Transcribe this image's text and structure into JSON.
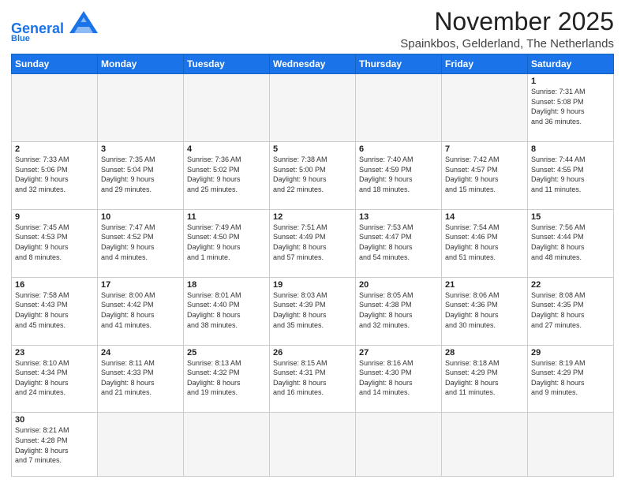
{
  "header": {
    "logo_general": "General",
    "logo_blue": "Blue",
    "month": "November 2025",
    "location": "Spainkbos, Gelderland, The Netherlands"
  },
  "days_of_week": [
    "Sunday",
    "Monday",
    "Tuesday",
    "Wednesday",
    "Thursday",
    "Friday",
    "Saturday"
  ],
  "weeks": [
    [
      {
        "day": "",
        "info": ""
      },
      {
        "day": "",
        "info": ""
      },
      {
        "day": "",
        "info": ""
      },
      {
        "day": "",
        "info": ""
      },
      {
        "day": "",
        "info": ""
      },
      {
        "day": "",
        "info": ""
      },
      {
        "day": "1",
        "info": "Sunrise: 7:31 AM\nSunset: 5:08 PM\nDaylight: 9 hours\nand 36 minutes."
      }
    ],
    [
      {
        "day": "2",
        "info": "Sunrise: 7:33 AM\nSunset: 5:06 PM\nDaylight: 9 hours\nand 32 minutes."
      },
      {
        "day": "3",
        "info": "Sunrise: 7:35 AM\nSunset: 5:04 PM\nDaylight: 9 hours\nand 29 minutes."
      },
      {
        "day": "4",
        "info": "Sunrise: 7:36 AM\nSunset: 5:02 PM\nDaylight: 9 hours\nand 25 minutes."
      },
      {
        "day": "5",
        "info": "Sunrise: 7:38 AM\nSunset: 5:00 PM\nDaylight: 9 hours\nand 22 minutes."
      },
      {
        "day": "6",
        "info": "Sunrise: 7:40 AM\nSunset: 4:59 PM\nDaylight: 9 hours\nand 18 minutes."
      },
      {
        "day": "7",
        "info": "Sunrise: 7:42 AM\nSunset: 4:57 PM\nDaylight: 9 hours\nand 15 minutes."
      },
      {
        "day": "8",
        "info": "Sunrise: 7:44 AM\nSunset: 4:55 PM\nDaylight: 9 hours\nand 11 minutes."
      }
    ],
    [
      {
        "day": "9",
        "info": "Sunrise: 7:45 AM\nSunset: 4:53 PM\nDaylight: 9 hours\nand 8 minutes."
      },
      {
        "day": "10",
        "info": "Sunrise: 7:47 AM\nSunset: 4:52 PM\nDaylight: 9 hours\nand 4 minutes."
      },
      {
        "day": "11",
        "info": "Sunrise: 7:49 AM\nSunset: 4:50 PM\nDaylight: 9 hours\nand 1 minute."
      },
      {
        "day": "12",
        "info": "Sunrise: 7:51 AM\nSunset: 4:49 PM\nDaylight: 8 hours\nand 57 minutes."
      },
      {
        "day": "13",
        "info": "Sunrise: 7:53 AM\nSunset: 4:47 PM\nDaylight: 8 hours\nand 54 minutes."
      },
      {
        "day": "14",
        "info": "Sunrise: 7:54 AM\nSunset: 4:46 PM\nDaylight: 8 hours\nand 51 minutes."
      },
      {
        "day": "15",
        "info": "Sunrise: 7:56 AM\nSunset: 4:44 PM\nDaylight: 8 hours\nand 48 minutes."
      }
    ],
    [
      {
        "day": "16",
        "info": "Sunrise: 7:58 AM\nSunset: 4:43 PM\nDaylight: 8 hours\nand 45 minutes."
      },
      {
        "day": "17",
        "info": "Sunrise: 8:00 AM\nSunset: 4:42 PM\nDaylight: 8 hours\nand 41 minutes."
      },
      {
        "day": "18",
        "info": "Sunrise: 8:01 AM\nSunset: 4:40 PM\nDaylight: 8 hours\nand 38 minutes."
      },
      {
        "day": "19",
        "info": "Sunrise: 8:03 AM\nSunset: 4:39 PM\nDaylight: 8 hours\nand 35 minutes."
      },
      {
        "day": "20",
        "info": "Sunrise: 8:05 AM\nSunset: 4:38 PM\nDaylight: 8 hours\nand 32 minutes."
      },
      {
        "day": "21",
        "info": "Sunrise: 8:06 AM\nSunset: 4:36 PM\nDaylight: 8 hours\nand 30 minutes."
      },
      {
        "day": "22",
        "info": "Sunrise: 8:08 AM\nSunset: 4:35 PM\nDaylight: 8 hours\nand 27 minutes."
      }
    ],
    [
      {
        "day": "23",
        "info": "Sunrise: 8:10 AM\nSunset: 4:34 PM\nDaylight: 8 hours\nand 24 minutes."
      },
      {
        "day": "24",
        "info": "Sunrise: 8:11 AM\nSunset: 4:33 PM\nDaylight: 8 hours\nand 21 minutes."
      },
      {
        "day": "25",
        "info": "Sunrise: 8:13 AM\nSunset: 4:32 PM\nDaylight: 8 hours\nand 19 minutes."
      },
      {
        "day": "26",
        "info": "Sunrise: 8:15 AM\nSunset: 4:31 PM\nDaylight: 8 hours\nand 16 minutes."
      },
      {
        "day": "27",
        "info": "Sunrise: 8:16 AM\nSunset: 4:30 PM\nDaylight: 8 hours\nand 14 minutes."
      },
      {
        "day": "28",
        "info": "Sunrise: 8:18 AM\nSunset: 4:29 PM\nDaylight: 8 hours\nand 11 minutes."
      },
      {
        "day": "29",
        "info": "Sunrise: 8:19 AM\nSunset: 4:29 PM\nDaylight: 8 hours\nand 9 minutes."
      }
    ],
    [
      {
        "day": "30",
        "info": "Sunrise: 8:21 AM\nSunset: 4:28 PM\nDaylight: 8 hours\nand 7 minutes."
      },
      {
        "day": "",
        "info": ""
      },
      {
        "day": "",
        "info": ""
      },
      {
        "day": "",
        "info": ""
      },
      {
        "day": "",
        "info": ""
      },
      {
        "day": "",
        "info": ""
      },
      {
        "day": "",
        "info": ""
      }
    ]
  ]
}
